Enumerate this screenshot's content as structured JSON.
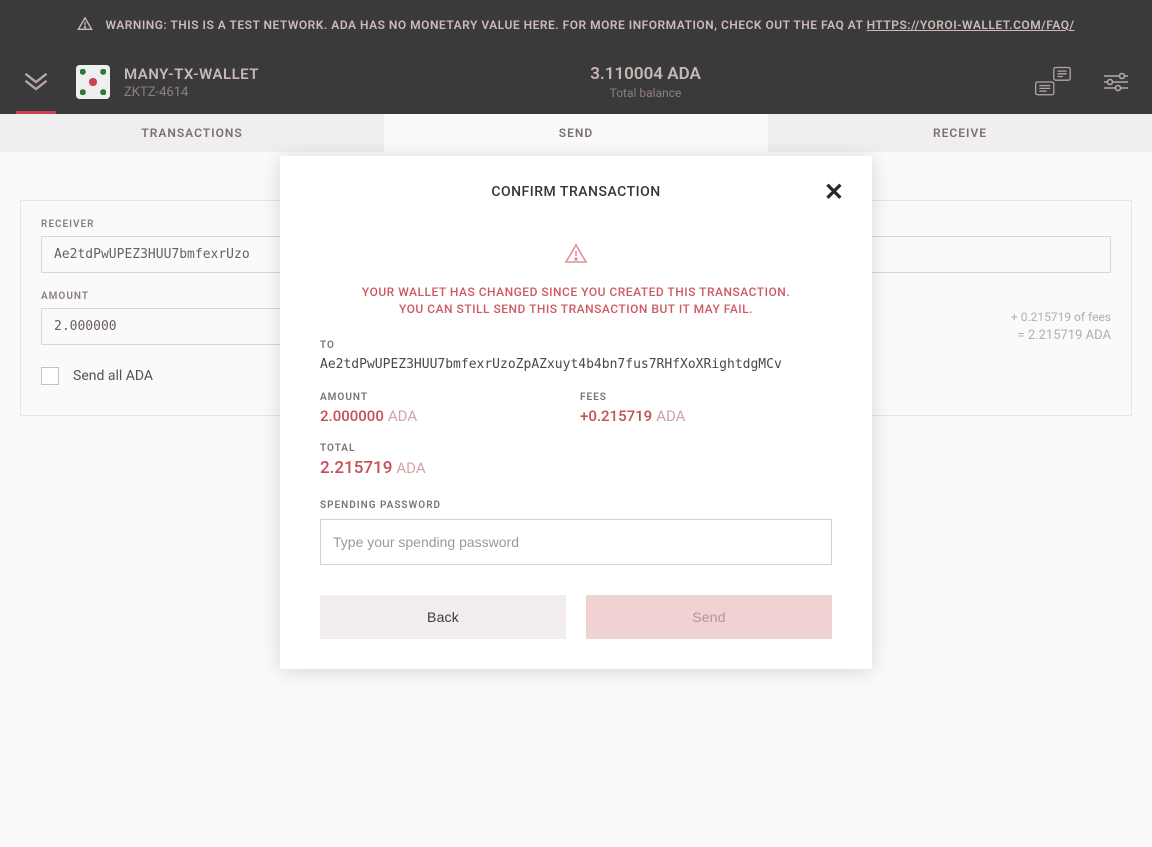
{
  "warning": {
    "text_prefix": "WARNING: THIS IS A TEST NETWORK. ADA HAS NO MONETARY VALUE HERE. FOR MORE INFORMATION, CHECK OUT THE FAQ AT ",
    "link_text": "HTTPS://YOROI-WALLET.COM/FAQ/"
  },
  "header": {
    "wallet_name": "MANY-TX-WALLET",
    "wallet_sub": "ZKTZ-4614",
    "balance_amount": "3.110004 ADA",
    "balance_label": "Total balance"
  },
  "tabs": {
    "transactions": "TRANSACTIONS",
    "send": "SEND",
    "receive": "RECEIVE"
  },
  "form": {
    "receiver_label": "RECEIVER",
    "receiver_value": "Ae2tdPwUPEZ3HUU7bmfexrUzo",
    "amount_label": "AMOUNT",
    "amount_value": "2.000000",
    "fees_text": "+ 0.215719 of fees",
    "total_text": "= 2.215719 ADA",
    "send_all_label": "Send all ADA"
  },
  "modal": {
    "title": "CONFIRM TRANSACTION",
    "warn_line1": "YOUR WALLET HAS CHANGED SINCE YOU CREATED THIS TRANSACTION.",
    "warn_line2": "YOU CAN STILL SEND THIS TRANSACTION BUT IT MAY FAIL.",
    "to_label": "TO",
    "to_address": "Ae2tdPwUPEZ3HUU7bmfexrUzoZpAZxuyt4b4bn7fus7RHfXoXRightdgMCv",
    "amount_label": "AMOUNT",
    "amount_value": "2.000000",
    "amount_unit": "ADA",
    "fees_label": "FEES",
    "fees_value": "+0.215719",
    "fees_unit": "ADA",
    "total_label": "TOTAL",
    "total_value": "2.215719",
    "total_unit": "ADA",
    "password_label": "SPENDING PASSWORD",
    "password_placeholder": "Type your spending password",
    "back_label": "Back",
    "send_label": "Send"
  }
}
